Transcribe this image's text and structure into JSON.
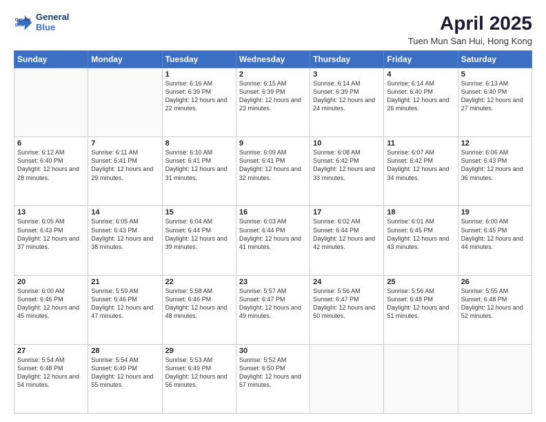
{
  "header": {
    "logo_line1": "General",
    "logo_line2": "Blue",
    "title": "April 2025",
    "subtitle": "Tuen Mun San Hui, Hong Kong"
  },
  "weekdays": [
    "Sunday",
    "Monday",
    "Tuesday",
    "Wednesday",
    "Thursday",
    "Friday",
    "Saturday"
  ],
  "weeks": [
    [
      {
        "day": "",
        "info": ""
      },
      {
        "day": "",
        "info": ""
      },
      {
        "day": "1",
        "info": "Sunrise: 6:16 AM\nSunset: 6:39 PM\nDaylight: 12 hours and 22 minutes."
      },
      {
        "day": "2",
        "info": "Sunrise: 6:15 AM\nSunset: 6:39 PM\nDaylight: 12 hours and 23 minutes."
      },
      {
        "day": "3",
        "info": "Sunrise: 6:14 AM\nSunset: 6:39 PM\nDaylight: 12 hours and 24 minutes."
      },
      {
        "day": "4",
        "info": "Sunrise: 6:14 AM\nSunset: 6:40 PM\nDaylight: 12 hours and 26 minutes."
      },
      {
        "day": "5",
        "info": "Sunrise: 6:13 AM\nSunset: 6:40 PM\nDaylight: 12 hours and 27 minutes."
      }
    ],
    [
      {
        "day": "6",
        "info": "Sunrise: 6:12 AM\nSunset: 6:40 PM\nDaylight: 12 hours and 28 minutes."
      },
      {
        "day": "7",
        "info": "Sunrise: 6:11 AM\nSunset: 6:41 PM\nDaylight: 12 hours and 29 minutes."
      },
      {
        "day": "8",
        "info": "Sunrise: 6:10 AM\nSunset: 6:41 PM\nDaylight: 12 hours and 31 minutes."
      },
      {
        "day": "9",
        "info": "Sunrise: 6:09 AM\nSunset: 6:41 PM\nDaylight: 12 hours and 32 minutes."
      },
      {
        "day": "10",
        "info": "Sunrise: 6:08 AM\nSunset: 6:42 PM\nDaylight: 12 hours and 33 minutes."
      },
      {
        "day": "11",
        "info": "Sunrise: 6:07 AM\nSunset: 6:42 PM\nDaylight: 12 hours and 34 minutes."
      },
      {
        "day": "12",
        "info": "Sunrise: 6:06 AM\nSunset: 6:43 PM\nDaylight: 12 hours and 36 minutes."
      }
    ],
    [
      {
        "day": "13",
        "info": "Sunrise: 6:05 AM\nSunset: 6:43 PM\nDaylight: 12 hours and 37 minutes."
      },
      {
        "day": "14",
        "info": "Sunrise: 6:05 AM\nSunset: 6:43 PM\nDaylight: 12 hours and 38 minutes."
      },
      {
        "day": "15",
        "info": "Sunrise: 6:04 AM\nSunset: 6:44 PM\nDaylight: 12 hours and 39 minutes."
      },
      {
        "day": "16",
        "info": "Sunrise: 6:03 AM\nSunset: 6:44 PM\nDaylight: 12 hours and 41 minutes."
      },
      {
        "day": "17",
        "info": "Sunrise: 6:02 AM\nSunset: 6:44 PM\nDaylight: 12 hours and 42 minutes."
      },
      {
        "day": "18",
        "info": "Sunrise: 6:01 AM\nSunset: 6:45 PM\nDaylight: 12 hours and 43 minutes."
      },
      {
        "day": "19",
        "info": "Sunrise: 6:00 AM\nSunset: 6:45 PM\nDaylight: 12 hours and 44 minutes."
      }
    ],
    [
      {
        "day": "20",
        "info": "Sunrise: 6:00 AM\nSunset: 6:46 PM\nDaylight: 12 hours and 45 minutes."
      },
      {
        "day": "21",
        "info": "Sunrise: 5:59 AM\nSunset: 6:46 PM\nDaylight: 12 hours and 47 minutes."
      },
      {
        "day": "22",
        "info": "Sunrise: 5:58 AM\nSunset: 6:46 PM\nDaylight: 12 hours and 48 minutes."
      },
      {
        "day": "23",
        "info": "Sunrise: 5:57 AM\nSunset: 6:47 PM\nDaylight: 12 hours and 49 minutes."
      },
      {
        "day": "24",
        "info": "Sunrise: 5:56 AM\nSunset: 6:47 PM\nDaylight: 12 hours and 50 minutes."
      },
      {
        "day": "25",
        "info": "Sunrise: 5:56 AM\nSunset: 6:48 PM\nDaylight: 12 hours and 51 minutes."
      },
      {
        "day": "26",
        "info": "Sunrise: 5:55 AM\nSunset: 6:48 PM\nDaylight: 12 hours and 52 minutes."
      }
    ],
    [
      {
        "day": "27",
        "info": "Sunrise: 5:54 AM\nSunset: 6:48 PM\nDaylight: 12 hours and 54 minutes."
      },
      {
        "day": "28",
        "info": "Sunrise: 5:54 AM\nSunset: 6:49 PM\nDaylight: 12 hours and 55 minutes."
      },
      {
        "day": "29",
        "info": "Sunrise: 5:53 AM\nSunset: 6:49 PM\nDaylight: 12 hours and 56 minutes."
      },
      {
        "day": "30",
        "info": "Sunrise: 5:52 AM\nSunset: 6:50 PM\nDaylight: 12 hours and 57 minutes."
      },
      {
        "day": "",
        "info": ""
      },
      {
        "day": "",
        "info": ""
      },
      {
        "day": "",
        "info": ""
      }
    ]
  ]
}
